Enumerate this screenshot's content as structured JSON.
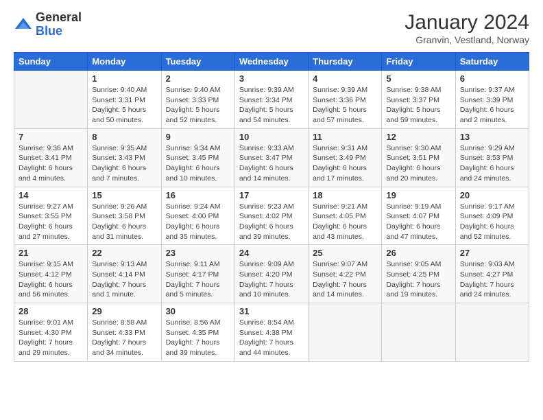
{
  "header": {
    "logo_general": "General",
    "logo_blue": "Blue",
    "month_title": "January 2024",
    "location": "Granvin, Vestland, Norway"
  },
  "days_of_week": [
    "Sunday",
    "Monday",
    "Tuesday",
    "Wednesday",
    "Thursday",
    "Friday",
    "Saturday"
  ],
  "weeks": [
    {
      "alt": false,
      "days": [
        {
          "num": "",
          "info": ""
        },
        {
          "num": "1",
          "info": "Sunrise: 9:40 AM\nSunset: 3:31 PM\nDaylight: 5 hours\nand 50 minutes."
        },
        {
          "num": "2",
          "info": "Sunrise: 9:40 AM\nSunset: 3:33 PM\nDaylight: 5 hours\nand 52 minutes."
        },
        {
          "num": "3",
          "info": "Sunrise: 9:39 AM\nSunset: 3:34 PM\nDaylight: 5 hours\nand 54 minutes."
        },
        {
          "num": "4",
          "info": "Sunrise: 9:39 AM\nSunset: 3:36 PM\nDaylight: 5 hours\nand 57 minutes."
        },
        {
          "num": "5",
          "info": "Sunrise: 9:38 AM\nSunset: 3:37 PM\nDaylight: 5 hours\nand 59 minutes."
        },
        {
          "num": "6",
          "info": "Sunrise: 9:37 AM\nSunset: 3:39 PM\nDaylight: 6 hours\nand 2 minutes."
        }
      ]
    },
    {
      "alt": true,
      "days": [
        {
          "num": "7",
          "info": "Sunrise: 9:36 AM\nSunset: 3:41 PM\nDaylight: 6 hours\nand 4 minutes."
        },
        {
          "num": "8",
          "info": "Sunrise: 9:35 AM\nSunset: 3:43 PM\nDaylight: 6 hours\nand 7 minutes."
        },
        {
          "num": "9",
          "info": "Sunrise: 9:34 AM\nSunset: 3:45 PM\nDaylight: 6 hours\nand 10 minutes."
        },
        {
          "num": "10",
          "info": "Sunrise: 9:33 AM\nSunset: 3:47 PM\nDaylight: 6 hours\nand 14 minutes."
        },
        {
          "num": "11",
          "info": "Sunrise: 9:31 AM\nSunset: 3:49 PM\nDaylight: 6 hours\nand 17 minutes."
        },
        {
          "num": "12",
          "info": "Sunrise: 9:30 AM\nSunset: 3:51 PM\nDaylight: 6 hours\nand 20 minutes."
        },
        {
          "num": "13",
          "info": "Sunrise: 9:29 AM\nSunset: 3:53 PM\nDaylight: 6 hours\nand 24 minutes."
        }
      ]
    },
    {
      "alt": false,
      "days": [
        {
          "num": "14",
          "info": "Sunrise: 9:27 AM\nSunset: 3:55 PM\nDaylight: 6 hours\nand 27 minutes."
        },
        {
          "num": "15",
          "info": "Sunrise: 9:26 AM\nSunset: 3:58 PM\nDaylight: 6 hours\nand 31 minutes."
        },
        {
          "num": "16",
          "info": "Sunrise: 9:24 AM\nSunset: 4:00 PM\nDaylight: 6 hours\nand 35 minutes."
        },
        {
          "num": "17",
          "info": "Sunrise: 9:23 AM\nSunset: 4:02 PM\nDaylight: 6 hours\nand 39 minutes."
        },
        {
          "num": "18",
          "info": "Sunrise: 9:21 AM\nSunset: 4:05 PM\nDaylight: 6 hours\nand 43 minutes."
        },
        {
          "num": "19",
          "info": "Sunrise: 9:19 AM\nSunset: 4:07 PM\nDaylight: 6 hours\nand 47 minutes."
        },
        {
          "num": "20",
          "info": "Sunrise: 9:17 AM\nSunset: 4:09 PM\nDaylight: 6 hours\nand 52 minutes."
        }
      ]
    },
    {
      "alt": true,
      "days": [
        {
          "num": "21",
          "info": "Sunrise: 9:15 AM\nSunset: 4:12 PM\nDaylight: 6 hours\nand 56 minutes."
        },
        {
          "num": "22",
          "info": "Sunrise: 9:13 AM\nSunset: 4:14 PM\nDaylight: 7 hours\nand 1 minute."
        },
        {
          "num": "23",
          "info": "Sunrise: 9:11 AM\nSunset: 4:17 PM\nDaylight: 7 hours\nand 5 minutes."
        },
        {
          "num": "24",
          "info": "Sunrise: 9:09 AM\nSunset: 4:20 PM\nDaylight: 7 hours\nand 10 minutes."
        },
        {
          "num": "25",
          "info": "Sunrise: 9:07 AM\nSunset: 4:22 PM\nDaylight: 7 hours\nand 14 minutes."
        },
        {
          "num": "26",
          "info": "Sunrise: 9:05 AM\nSunset: 4:25 PM\nDaylight: 7 hours\nand 19 minutes."
        },
        {
          "num": "27",
          "info": "Sunrise: 9:03 AM\nSunset: 4:27 PM\nDaylight: 7 hours\nand 24 minutes."
        }
      ]
    },
    {
      "alt": false,
      "days": [
        {
          "num": "28",
          "info": "Sunrise: 9:01 AM\nSunset: 4:30 PM\nDaylight: 7 hours\nand 29 minutes."
        },
        {
          "num": "29",
          "info": "Sunrise: 8:58 AM\nSunset: 4:33 PM\nDaylight: 7 hours\nand 34 minutes."
        },
        {
          "num": "30",
          "info": "Sunrise: 8:56 AM\nSunset: 4:35 PM\nDaylight: 7 hours\nand 39 minutes."
        },
        {
          "num": "31",
          "info": "Sunrise: 8:54 AM\nSunset: 4:38 PM\nDaylight: 7 hours\nand 44 minutes."
        },
        {
          "num": "",
          "info": ""
        },
        {
          "num": "",
          "info": ""
        },
        {
          "num": "",
          "info": ""
        }
      ]
    }
  ]
}
